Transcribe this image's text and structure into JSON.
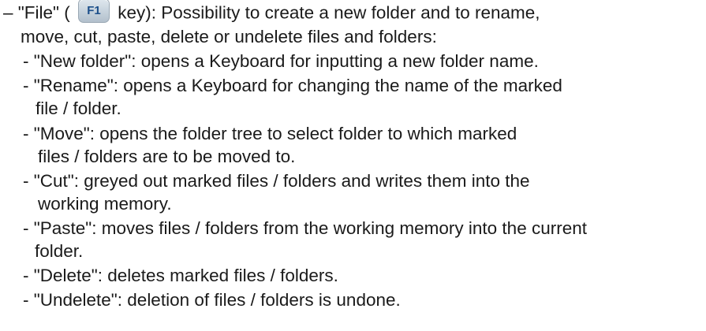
{
  "file_key": {
    "before_key": "– \"File\" (",
    "key_label": "F1",
    "after_key": "key): Possibility to create a new folder and to rename,",
    "continuation": "move, cut, paste, delete or undelete files and folders:"
  },
  "items": {
    "new_folder": "- \"New folder\": opens a Keyboard for inputting a new folder name.",
    "rename_1": "- \"Rename\": opens a Keyboard for changing the name of the marked",
    "rename_2": "file / folder.",
    "move_1": "- \"Move\": opens the folder tree to select folder to which marked",
    "move_2": "files / folders are to be moved to.",
    "cut_1": "- \"Cut\": greyed out marked files / folders and writes them into the",
    "cut_2": "working memory.",
    "paste_1": "- \"Paste\": moves files / folders from the working memory into the current",
    "paste_2": "folder.",
    "delete": "- \"Delete\": deletes marked files / folders.",
    "undelete": "- \"Undelete\": deletion of files / folders is undone."
  }
}
